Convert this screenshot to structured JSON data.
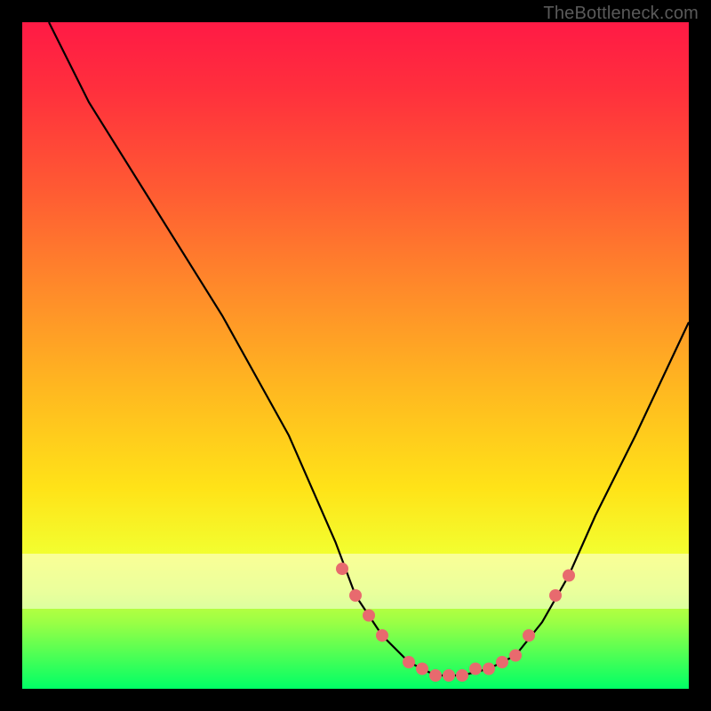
{
  "watermark": "TheBottleneck.com",
  "colors": {
    "background": "#000000",
    "curve": "#000000",
    "markers": "#e86a6e"
  },
  "chart_data": {
    "type": "line",
    "title": "",
    "xlabel": "",
    "ylabel": "",
    "xlim": [
      0,
      100
    ],
    "ylim": [
      0,
      100
    ],
    "legend": false,
    "grid": false,
    "series": [
      {
        "name": "bottleneck-curve",
        "x": [
          4,
          10,
          20,
          30,
          40,
          47,
          50,
          54,
          58,
          62,
          66,
          70,
          74,
          78,
          82,
          86,
          92,
          100
        ],
        "y": [
          100,
          88,
          72,
          56,
          38,
          22,
          14,
          8,
          4,
          2,
          2,
          3,
          5,
          10,
          17,
          26,
          38,
          55
        ]
      }
    ],
    "markers": {
      "name": "highlighted-points",
      "x": [
        48,
        50,
        52,
        54,
        58,
        60,
        62,
        64,
        66,
        68,
        70,
        72,
        74,
        76,
        80,
        82
      ],
      "y": [
        18,
        14,
        11,
        8,
        4,
        3,
        2,
        2,
        2,
        3,
        3,
        4,
        5,
        8,
        14,
        17
      ]
    }
  }
}
